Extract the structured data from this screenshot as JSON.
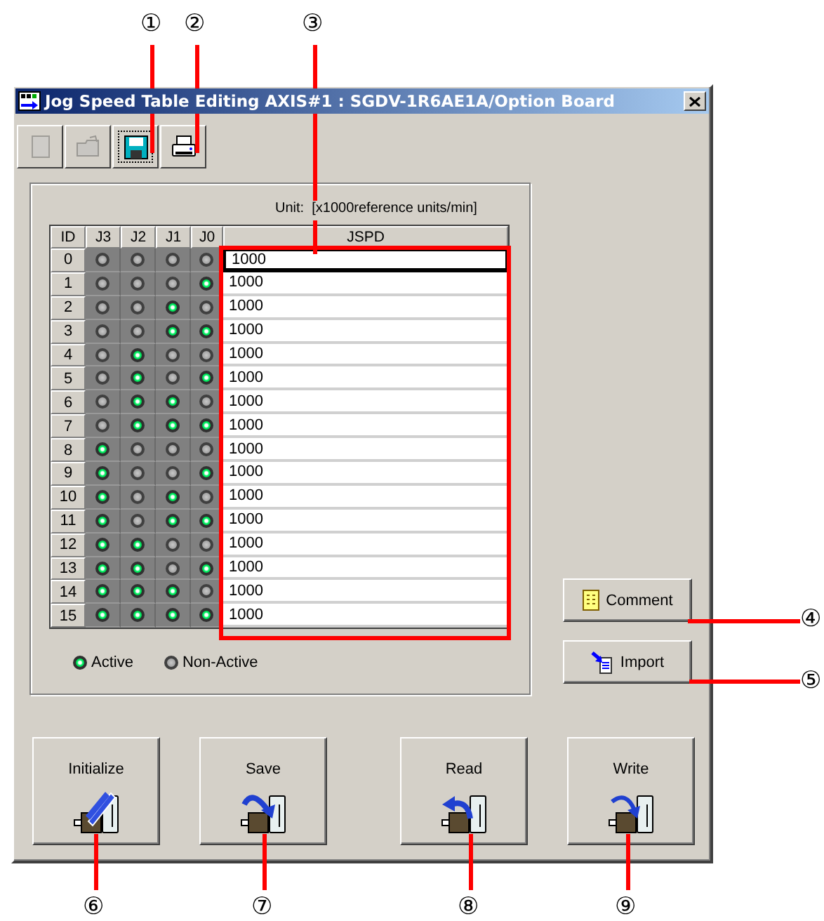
{
  "window": {
    "title": "Jog Speed Table Editing AXIS#1 : SGDV-1R6AE1A/Option Board"
  },
  "toolbar": [
    {
      "kind": "new",
      "disabled": true,
      "focused": false
    },
    {
      "kind": "open",
      "disabled": true,
      "focused": false
    },
    {
      "kind": "save",
      "disabled": false,
      "focused": true
    },
    {
      "kind": "print",
      "disabled": false,
      "focused": false
    }
  ],
  "unit_label": "Unit:  [x1000reference units/min]",
  "table": {
    "columns": [
      "ID",
      "J3",
      "J2",
      "J1",
      "J0",
      "JSPD"
    ],
    "rows": [
      {
        "id": "0",
        "lamps": [
          false,
          false,
          false,
          false
        ],
        "jspd": "1000",
        "selected": true
      },
      {
        "id": "1",
        "lamps": [
          false,
          false,
          false,
          true
        ],
        "jspd": "1000",
        "selected": false
      },
      {
        "id": "2",
        "lamps": [
          false,
          false,
          true,
          false
        ],
        "jspd": "1000",
        "selected": false
      },
      {
        "id": "3",
        "lamps": [
          false,
          false,
          true,
          true
        ],
        "jspd": "1000",
        "selected": false
      },
      {
        "id": "4",
        "lamps": [
          false,
          true,
          false,
          false
        ],
        "jspd": "1000",
        "selected": false
      },
      {
        "id": "5",
        "lamps": [
          false,
          true,
          false,
          true
        ],
        "jspd": "1000",
        "selected": false
      },
      {
        "id": "6",
        "lamps": [
          false,
          true,
          true,
          false
        ],
        "jspd": "1000",
        "selected": false
      },
      {
        "id": "7",
        "lamps": [
          false,
          true,
          true,
          true
        ],
        "jspd": "1000",
        "selected": false
      },
      {
        "id": "8",
        "lamps": [
          true,
          false,
          false,
          false
        ],
        "jspd": "1000",
        "selected": false
      },
      {
        "id": "9",
        "lamps": [
          true,
          false,
          false,
          true
        ],
        "jspd": "1000",
        "selected": false
      },
      {
        "id": "10",
        "lamps": [
          true,
          false,
          true,
          false
        ],
        "jspd": "1000",
        "selected": false
      },
      {
        "id": "11",
        "lamps": [
          true,
          false,
          true,
          true
        ],
        "jspd": "1000",
        "selected": false
      },
      {
        "id": "12",
        "lamps": [
          true,
          true,
          false,
          false
        ],
        "jspd": "1000",
        "selected": false
      },
      {
        "id": "13",
        "lamps": [
          true,
          true,
          false,
          true
        ],
        "jspd": "1000",
        "selected": false
      },
      {
        "id": "14",
        "lamps": [
          true,
          true,
          true,
          false
        ],
        "jspd": "1000",
        "selected": false
      },
      {
        "id": "15",
        "lamps": [
          true,
          true,
          true,
          true
        ],
        "jspd": "1000",
        "selected": false
      }
    ]
  },
  "legend": [
    {
      "kind": "active",
      "label": "Active"
    },
    {
      "kind": "inactive",
      "label": "Non-Active"
    }
  ],
  "side_buttons": [
    {
      "kind": "comment",
      "label": "Comment"
    },
    {
      "kind": "import",
      "label": "Import"
    }
  ],
  "action_buttons": [
    {
      "kind": "initialize",
      "label": "Initialize"
    },
    {
      "kind": "save",
      "label": "Save"
    },
    {
      "kind": "read",
      "label": "Read"
    },
    {
      "kind": "write",
      "label": "Write"
    }
  ],
  "callouts": [
    "①",
    "②",
    "③",
    "④",
    "⑤",
    "⑥",
    "⑦",
    "⑧",
    "⑨"
  ]
}
